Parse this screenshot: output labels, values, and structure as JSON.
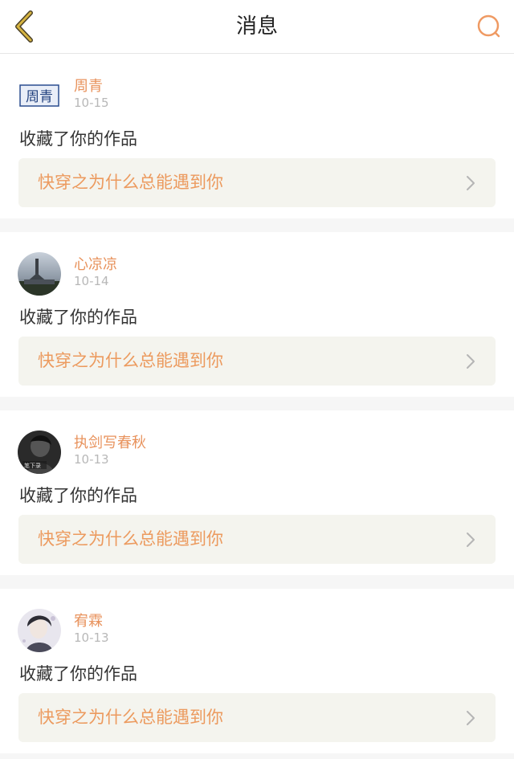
{
  "header": {
    "title": "消息",
    "back_icon": "chevron-left-icon",
    "search_icon": "search-icon",
    "accent_color": "#e8925c",
    "back_color": "#c9a73a"
  },
  "messages": [
    {
      "username": "周青",
      "date": "10-15",
      "avatar_text": "周青",
      "action": "收藏了你的作品",
      "work_title": "快穿之为什么总能遇到你"
    },
    {
      "username": "心凉凉",
      "date": "10-14",
      "action": "收藏了你的作品",
      "work_title": "快穿之为什么总能遇到你"
    },
    {
      "username": "执剑写春秋",
      "date": "10-13",
      "avatar_text": "笔下录",
      "action": "收藏了你的作品",
      "work_title": "快穿之为什么总能遇到你"
    },
    {
      "username": "宥霖",
      "date": "10-13",
      "action": "收藏了你的作品",
      "work_title": "快穿之为什么总能遇到你"
    }
  ]
}
